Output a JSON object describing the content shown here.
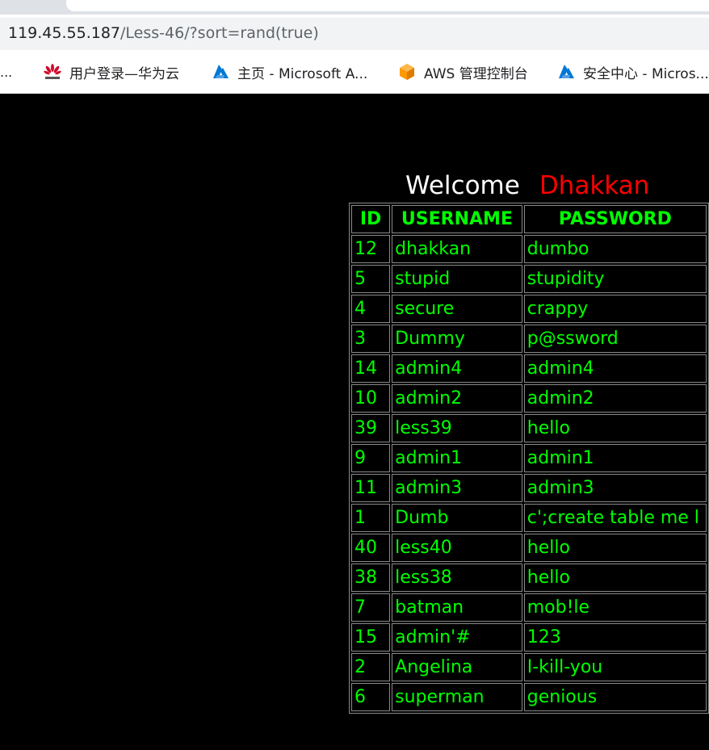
{
  "browser": {
    "url_host": "119.45.55.187",
    "url_path": "/Less-46/?sort=rand(true)",
    "bookmarks_overflow": "...",
    "bookmarks": [
      {
        "label": "用户登录—华为云",
        "icon": "huawei-icon",
        "color": "#cf0a2c"
      },
      {
        "label": "主页 - Microsoft A...",
        "icon": "azure-icon",
        "color": "#0078d4"
      },
      {
        "label": "AWS 管理控制台",
        "icon": "aws-icon",
        "color": "#ff9900"
      },
      {
        "label": "安全中心 - Micros...",
        "icon": "azure-icon",
        "color": "#0078d4"
      }
    ]
  },
  "page": {
    "welcome": "Welcome",
    "name": "Dhakkan",
    "colors": {
      "background": "#000000",
      "text": "#00ff00",
      "name": "#ff0000"
    },
    "table": {
      "headers": [
        "ID",
        "USERNAME",
        "PASSWORD"
      ],
      "rows": [
        [
          "12",
          "dhakkan",
          "dumbo"
        ],
        [
          "5",
          "stupid",
          "stupidity"
        ],
        [
          "4",
          "secure",
          "crappy"
        ],
        [
          "3",
          "Dummy",
          "p@ssword"
        ],
        [
          "14",
          "admin4",
          "admin4"
        ],
        [
          "10",
          "admin2",
          "admin2"
        ],
        [
          "39",
          "less39",
          "hello"
        ],
        [
          "9",
          "admin1",
          "admin1"
        ],
        [
          "11",
          "admin3",
          "admin3"
        ],
        [
          "1",
          "Dumb",
          "c';create table me l"
        ],
        [
          "40",
          "less40",
          "hello"
        ],
        [
          "38",
          "less38",
          "hello"
        ],
        [
          "7",
          "batman",
          "mob!le"
        ],
        [
          "15",
          "admin'#",
          "123"
        ],
        [
          "2",
          "Angelina",
          "I-kill-you"
        ],
        [
          "6",
          "superman",
          "genious"
        ]
      ]
    }
  }
}
